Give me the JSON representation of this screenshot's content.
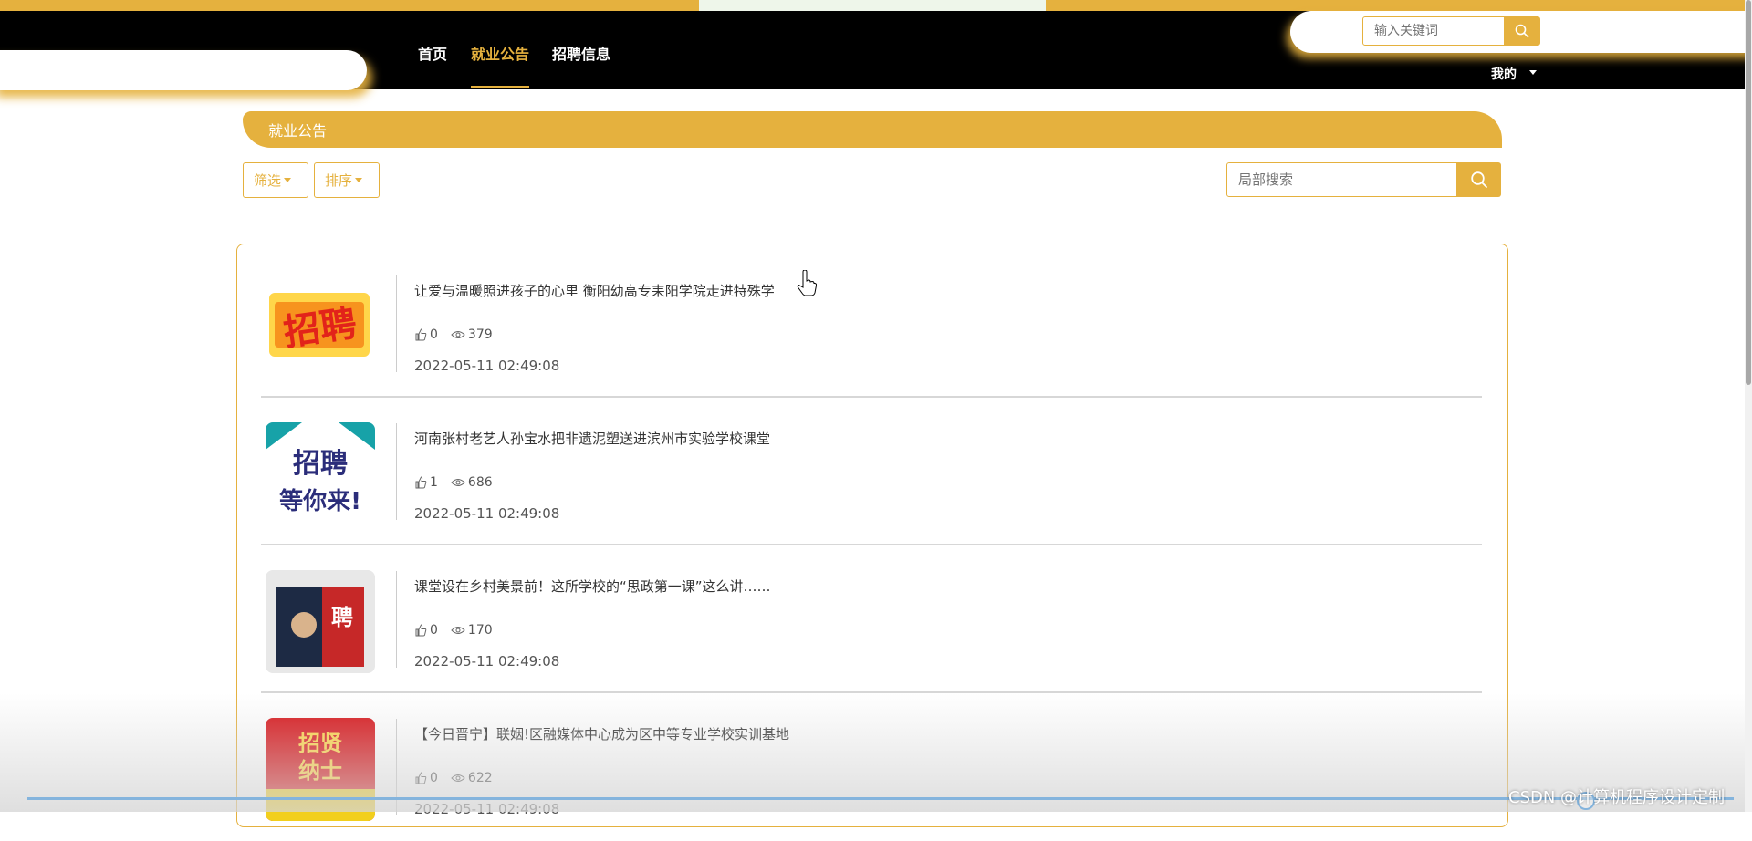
{
  "colors": {
    "accent": "#e5b13e",
    "navbar_bg": "#000000",
    "text": "#333333",
    "muted": "#555555"
  },
  "nav": {
    "items": [
      {
        "label": "首页",
        "active": false
      },
      {
        "label": "就业公告",
        "active": true
      },
      {
        "label": "招聘信息",
        "active": false
      }
    ],
    "keyword_placeholder": "输入关键词",
    "mine_label": "我的"
  },
  "section": {
    "title": "就业公告",
    "filter_label": "筛选",
    "sort_label": "排序",
    "local_search_placeholder": "局部搜索"
  },
  "announcements": [
    {
      "title": "让爱与温暖照进孩子的心里 衡阳幼高专耒阳学院走进特殊学",
      "likes": "0",
      "views": "379",
      "date": "2022-05-11 02:49:08",
      "thumb_text": "招聘"
    },
    {
      "title": "河南张村老艺人孙宝水把非遗泥塑送进滨州市实验学校课堂",
      "likes": "1",
      "views": "686",
      "date": "2022-05-11 02:49:08",
      "thumb_text": "招聘 等你来!"
    },
    {
      "title": "课堂设在乡村美景前！这所学校的“思政第一课”这么讲……",
      "likes": "0",
      "views": "170",
      "date": "2022-05-11 02:49:08",
      "thumb_text": "聘"
    },
    {
      "title": "【今日晋宁】联姻!区融媒体中心成为区中等专业学校实训基地",
      "likes": "0",
      "views": "622",
      "date": "2022-05-11 02:49:08",
      "thumb_text": "招贤纳士"
    }
  ],
  "watermark": "CSDN @计算机程序设计定制"
}
